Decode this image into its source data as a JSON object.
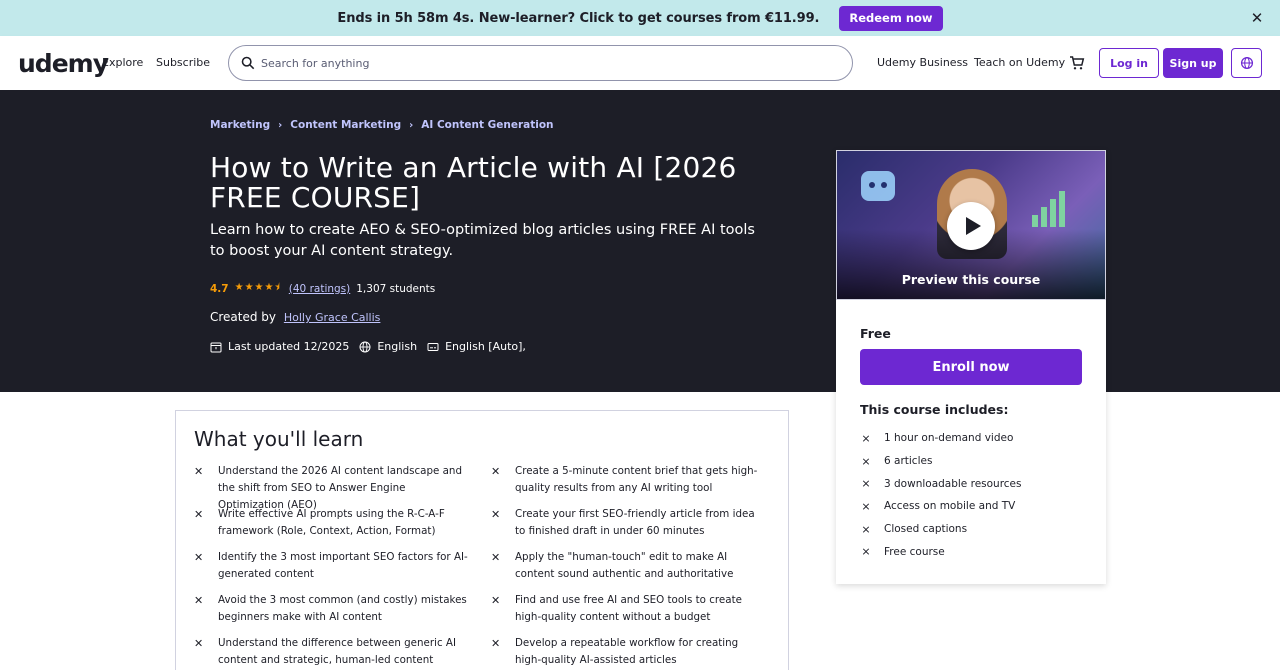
{
  "promo": {
    "text": "Ends in 5h 58m 4s. New-learner? Click to get courses from €11.99.",
    "button": "Redeem now",
    "close_icon": "close-icon"
  },
  "header": {
    "logo": "udemy",
    "explore": "Explore",
    "subscribe": "Subscribe",
    "search_placeholder": "Search for anything",
    "business": "Udemy Business",
    "teach": "Teach on Udemy",
    "login": "Log in",
    "signup": "Sign up"
  },
  "breadcrumbs": [
    "Marketing",
    "Content Marketing",
    "AI Content Generation"
  ],
  "course": {
    "title": "How to Write an Article with AI [2026 FREE COURSE]",
    "subtitle": "Learn how to create AEO & SEO-optimized blog articles using FREE AI tools to boost your AI content strategy.",
    "rating": "4.7",
    "stars": 4.5,
    "ratings_count": "(40 ratings)",
    "students": "1,307 students",
    "created_by_label": "Created by",
    "instructor": "Holly Grace Callis",
    "last_updated": "Last updated 12/2025",
    "language": "English",
    "captions": "English [Auto],"
  },
  "sidebar": {
    "preview_label": "Preview this course",
    "price": "Free",
    "enroll": "Enroll now",
    "includes_title": "This course includes:",
    "includes": [
      "1 hour on-demand video",
      "6 articles",
      "3 downloadable resources",
      "Access on mobile and TV",
      "Closed captions",
      "Free course"
    ]
  },
  "learn": {
    "title": "What you'll learn",
    "left": [
      "Understand the 2026 AI content landscape and the shift from SEO to Answer Engine Optimization (AEO)",
      "Write effective AI prompts using the R-C-A-F framework (Role, Context, Action, Format)",
      "Identify the 3 most important SEO factors for AI-generated content",
      "Avoid the 3 most common (and costly) mistakes beginners make with AI content",
      "Understand the difference between generic AI content and strategic, human-led content"
    ],
    "right": [
      "Create a 5-minute content brief that gets high-quality results from any AI writing tool",
      "Create your first SEO-friendly article from idea to finished draft in under 60 minutes",
      "Apply the \"human-touch\" edit to make AI content sound authentic and authoritative",
      "Find and use free AI and SEO tools to create high-quality content without a budget",
      "Develop a repeatable workflow for creating high-quality AI-assisted articles"
    ]
  },
  "colors": {
    "brand": "#6d28d2",
    "hero_bg": "#1d1e27",
    "promo_bg": "#c2e9eb",
    "star": "#f69c08",
    "link_light": "#c0c4fc"
  }
}
